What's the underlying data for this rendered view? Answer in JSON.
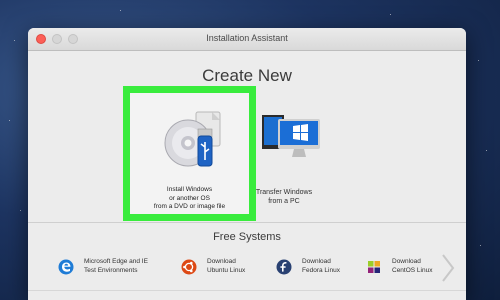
{
  "window": {
    "title": "Installation Assistant"
  },
  "header": {
    "title": "Create New"
  },
  "options": {
    "install": {
      "label_lines": [
        "Install Windows",
        "or another OS",
        "from a DVD or image file"
      ],
      "icon": "dvd-usb-icon"
    },
    "transfer": {
      "label_lines": [
        "Transfer Windows",
        "from a PC"
      ],
      "icon": "pc-transfer-icon"
    }
  },
  "free_systems": {
    "title": "Free Systems",
    "items": [
      {
        "line1": "Microsoft Edge and IE",
        "line2": "Test Environments",
        "icon": "edge-icon"
      },
      {
        "line1": "Download",
        "line2": "Ubuntu Linux",
        "icon": "ubuntu-icon"
      },
      {
        "line1": "Download",
        "line2": "Fedora Linux",
        "icon": "fedora-icon"
      },
      {
        "line1": "Download",
        "line2": "CentOS Linux",
        "icon": "centos-icon"
      }
    ]
  },
  "colors": {
    "selection_border": "#39ec3d",
    "close_button": "#fc5f57",
    "edge_blue": "#1f7cd6",
    "ubuntu_orange": "#dd4814",
    "fedora_blue": "#294172"
  }
}
